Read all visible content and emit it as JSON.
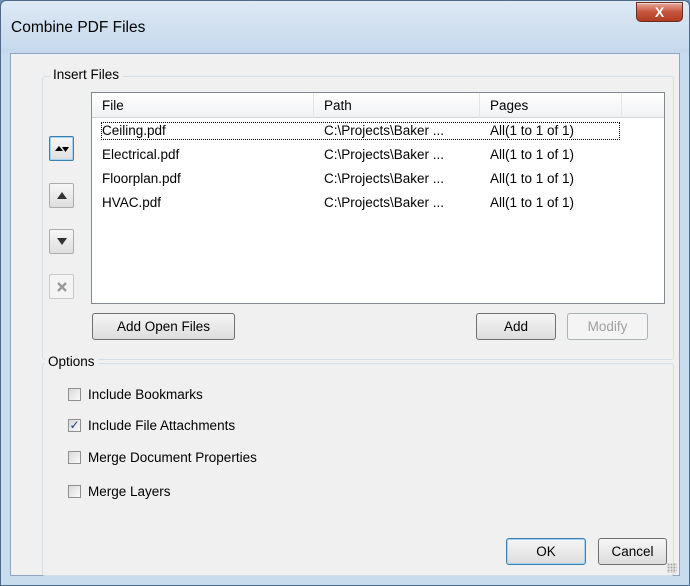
{
  "window": {
    "title": "Combine PDF Files",
    "close_glyph": "X"
  },
  "insert_files": {
    "legend": "Insert Files",
    "columns": [
      "File",
      "Path",
      "Pages"
    ],
    "rows": [
      {
        "file": "Ceiling.pdf",
        "path": "C:\\Projects\\Baker ...",
        "pages": "All(1 to 1 of 1)"
      },
      {
        "file": "Electrical.pdf",
        "path": "C:\\Projects\\Baker ...",
        "pages": "All(1 to 1 of 1)"
      },
      {
        "file": "Floorplan.pdf",
        "path": "C:\\Projects\\Baker ...",
        "pages": "All(1 to 1 of 1)"
      },
      {
        "file": "HVAC.pdf",
        "path": "C:\\Projects\\Baker ...",
        "pages": "All(1 to 1 of 1)"
      }
    ],
    "side_buttons": {
      "sort_icon": "sort-up-down-icon",
      "up_icon": "move-up-icon",
      "down_icon": "move-down-icon",
      "remove_icon": "remove-x-icon"
    },
    "add_open_files_label": "Add Open Files",
    "add_label": "Add",
    "modify_label": "Modify"
  },
  "options": {
    "legend": "Options",
    "items": [
      {
        "label": "Include Bookmarks",
        "checked": false
      },
      {
        "label": "Include File Attachments",
        "checked": true
      },
      {
        "label": "Merge Document Properties",
        "checked": false
      },
      {
        "label": "Merge Layers",
        "checked": false
      }
    ]
  },
  "footer": {
    "ok_label": "OK",
    "cancel_label": "Cancel"
  }
}
